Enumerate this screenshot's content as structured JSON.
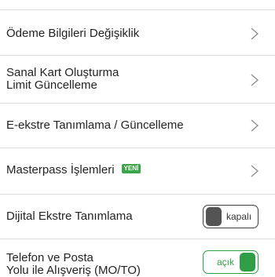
{
  "menu": {
    "items": [
      {
        "label": "Ödeme Bilgileri Değişiklik"
      },
      {
        "label_line1": "Sanal Kart Oluşturma",
        "label_line2": "Limit Güncelleme"
      },
      {
        "label": "E-ekstre Tanımlama / Güncelleme"
      },
      {
        "label": "Masterpass İşlemleri",
        "badge": "YENİ"
      },
      {
        "label": "Dijital Ekstre Tanımlama",
        "toggle_label": "kapalı",
        "toggle_state": "off"
      },
      {
        "label_line1": "Telefon ve Posta",
        "label_line2": "Yolu ile Alışveriş (MO/TO)",
        "toggle_label": "açık",
        "toggle_state": "on"
      }
    ]
  },
  "colors": {
    "accent_green": "#2f9e46",
    "badge_green": "#3aa549",
    "divider": "#dcdcdc",
    "toggle_off_knob": "#545454"
  },
  "icons": {
    "row_arrow": "chevron-right-icon"
  }
}
